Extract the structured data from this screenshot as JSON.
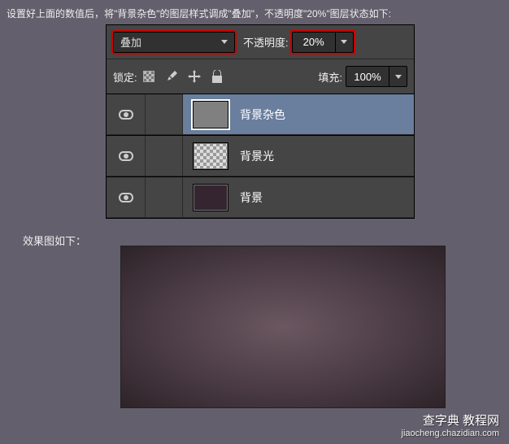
{
  "instruction": "设置好上面的数值后，将\"背景杂色\"的图层样式调成\"叠加\"，不透明度\"20%\"图层状态如下:",
  "blendMode": {
    "selected": "叠加"
  },
  "opacity": {
    "label": "不透明度:",
    "value": "20%"
  },
  "lock": {
    "label": "锁定:"
  },
  "fill": {
    "label": "填充:",
    "value": "100%"
  },
  "layers": [
    {
      "name": "背景杂色",
      "selected": true,
      "thumb": "noise"
    },
    {
      "name": "背景光",
      "selected": false,
      "thumb": "checker"
    },
    {
      "name": "背景",
      "selected": false,
      "thumb": "bg"
    }
  ],
  "resultLabel": "效果图如下：",
  "watermark": {
    "line1": "查字典 教程网",
    "line2": "jiaocheng.chazidian.com"
  }
}
